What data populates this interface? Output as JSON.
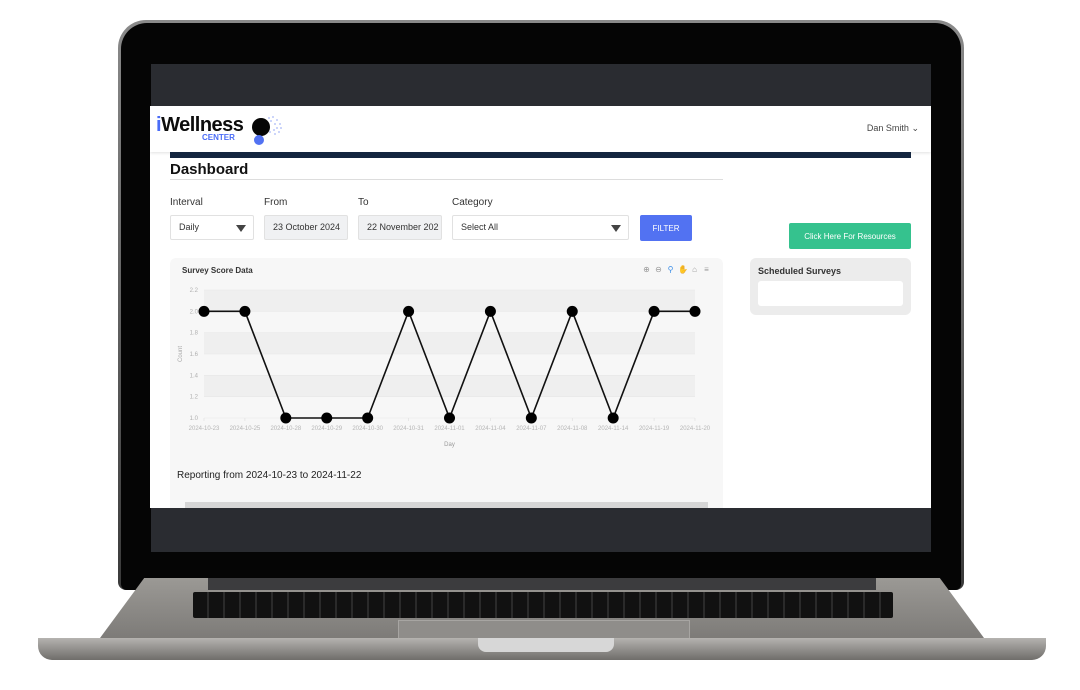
{
  "header": {
    "logo_main_i": "i",
    "logo_main_rest": "Wellness",
    "logo_sub": "CENTER",
    "user_name": "Dan Smith",
    "user_caret": "⌄"
  },
  "page": {
    "title": "Dashboard"
  },
  "filters": {
    "interval": {
      "label": "Interval",
      "value": "Daily"
    },
    "from": {
      "label": "From",
      "value": "23 October 2024"
    },
    "to": {
      "label": "To",
      "value": "22 November 202"
    },
    "category": {
      "label": "Category",
      "value": "Select All"
    },
    "filter_button": "FILTER"
  },
  "resources_button": "Click Here For Resources",
  "scheduled_surveys": {
    "title": "Scheduled Surveys"
  },
  "chart_toolbar": {
    "icons": [
      "zoom-in-icon",
      "zoom-out-icon",
      "zoom-select-icon",
      "pan-icon",
      "home-icon",
      "menu-icon"
    ],
    "glyphs": [
      "⊕",
      "⊖",
      "🔍",
      "✋",
      "⌂",
      "≡"
    ],
    "active": "zoom-select-icon"
  },
  "reporting_text": "Reporting from 2024-10-23 to 2024-11-22",
  "colors": {
    "brand_blue": "#5272f2",
    "resources_green": "#35c28e",
    "navy": "#14263f"
  },
  "chart_data": {
    "type": "line",
    "title": "Survey Score Data",
    "xlabel": "Day",
    "ylabel": "Count",
    "categories": [
      "2024-10-23",
      "2024-10-25",
      "2024-10-28",
      "2024-10-29",
      "2024-10-30",
      "2024-10-31",
      "2024-11-01",
      "2024-11-04",
      "2024-11-07",
      "2024-11-08",
      "2024-11-14",
      "2024-11-19",
      "2024-11-20"
    ],
    "values": [
      2,
      2,
      1,
      1,
      1,
      2,
      1,
      2,
      1,
      2,
      1,
      2,
      2
    ],
    "ylim": [
      1.0,
      2.2
    ],
    "yticks": [
      "1.0",
      "1.2",
      "1.4",
      "1.6",
      "1.8",
      "2.0",
      "2.2"
    ],
    "grid": true,
    "legend": "none"
  }
}
